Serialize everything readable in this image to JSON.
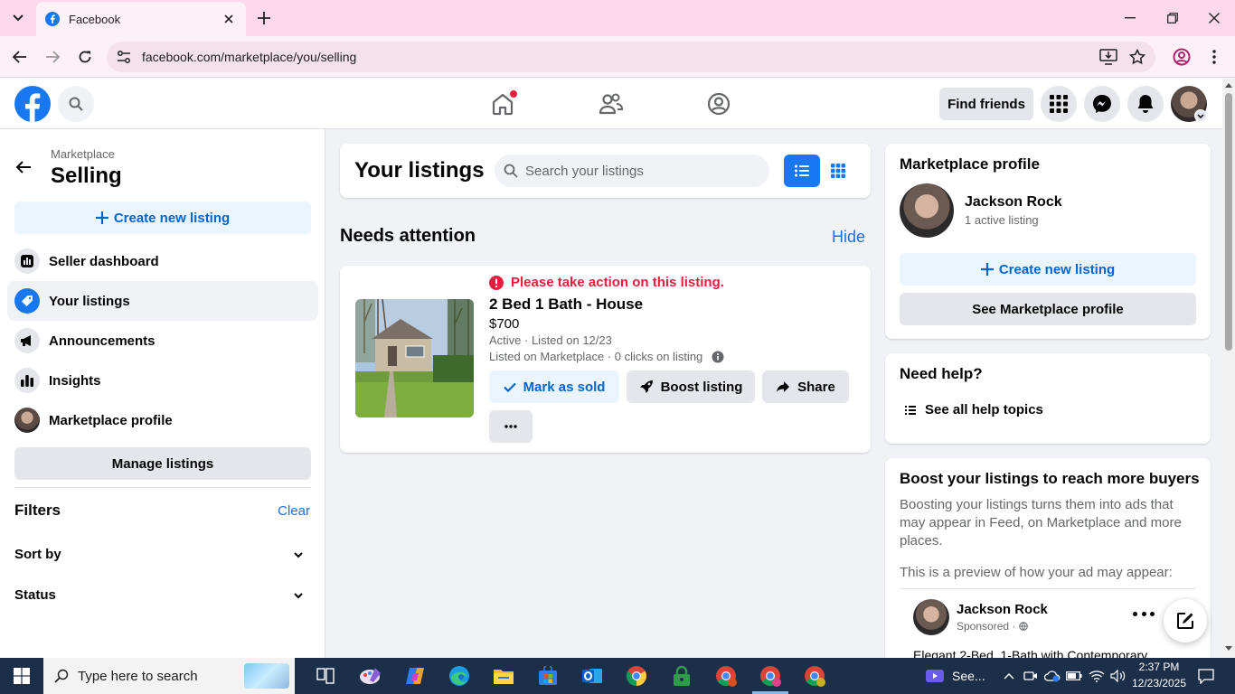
{
  "browser": {
    "tab_title": "Facebook",
    "url": "facebook.com/marketplace/you/selling"
  },
  "header": {
    "find_friends": "Find friends"
  },
  "sidebar": {
    "crumb": "Marketplace",
    "title": "Selling",
    "create_listing": "Create new listing",
    "items": [
      {
        "label": "Seller dashboard",
        "icon": "dashboard-icon"
      },
      {
        "label": "Your listings",
        "icon": "tag-icon"
      },
      {
        "label": "Announcements",
        "icon": "megaphone-icon"
      },
      {
        "label": "Insights",
        "icon": "insights-icon"
      },
      {
        "label": "Marketplace profile",
        "icon": "avatar"
      }
    ],
    "manage_listings": "Manage listings",
    "filters_title": "Filters",
    "clear": "Clear",
    "sort_by": "Sort by",
    "status": "Status"
  },
  "main": {
    "title": "Your listings",
    "search_placeholder": "Search your listings",
    "needs_attention": "Needs attention",
    "hide": "Hide",
    "listing": {
      "warning": "Please take action on this listing.",
      "title": "2 Bed 1 Bath - House",
      "price": "$700",
      "status": "Active · Listed on 12/23",
      "stats": "Listed on Marketplace · 0 clicks on listing",
      "mark_sold": "Mark as sold",
      "boost": "Boost listing",
      "share": "Share"
    }
  },
  "right": {
    "profile_title": "Marketplace profile",
    "profile_name": "Jackson Rock",
    "profile_sub": "1 active listing",
    "create_listing": "Create new listing",
    "see_profile": "See Marketplace profile",
    "help_title": "Need help?",
    "help_link": "See all help topics",
    "boost_title": "Boost your listings to reach more buyers",
    "boost_desc": "Boosting your listings turns them into ads that may appear in Feed, on Marketplace and more places.",
    "boost_preview": "This is a preview of how your ad may appear:",
    "ad_name": "Jackson Rock",
    "ad_sponsored": "Sponsored ·",
    "ad_text": "Elegant 2-Bed, 1-Bath with Contemporary"
  },
  "taskbar": {
    "search_placeholder": "Type here to search",
    "see_more": "See...",
    "time": "2:37 PM",
    "date": "12/23/2025"
  },
  "colors": {
    "fb_blue": "#1877f2",
    "link_blue": "#216fdb",
    "warning_red": "#e41e3f",
    "tab_bar_pink": "#fbd9ea"
  }
}
